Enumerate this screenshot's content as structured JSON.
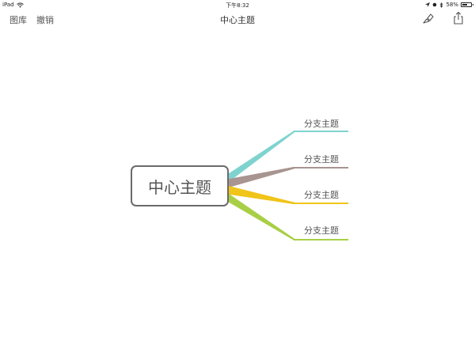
{
  "status_bar": {
    "device": "iPad",
    "time": "下午8:32",
    "battery": "58%",
    "battery_level": 0.58
  },
  "nav": {
    "library_label": "图库",
    "undo_label": "撤销",
    "title": "中心主题",
    "icons": {
      "style": "paintbrush-icon",
      "share": "share-icon"
    }
  },
  "mindmap": {
    "central_topic": "中心主题",
    "branches": [
      {
        "label": "分支主题",
        "color": "#7fd3cf"
      },
      {
        "label": "分支主题",
        "color": "#a89490"
      },
      {
        "label": "分支主题",
        "color": "#f0c419"
      },
      {
        "label": "分支主题",
        "color": "#a8cf45"
      }
    ],
    "border_color": "#6b6b6b"
  }
}
